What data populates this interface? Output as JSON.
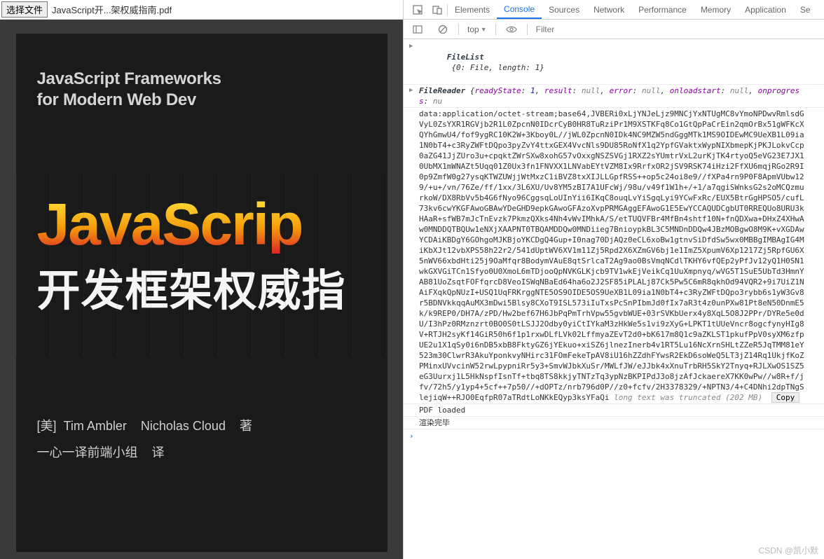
{
  "file_chooser": {
    "button_label": "选择文件",
    "file_name": "JavaScript开...架权威指南.pdf"
  },
  "book": {
    "subtitle_line1": "JavaScript Frameworks",
    "subtitle_line2": "for Modern Web Dev",
    "title_en": "JavaScrip",
    "title_cn": "开发框架权威指",
    "author_prefix": "[美]",
    "author1": "Tim Ambler",
    "author2": "Nicholas Cloud",
    "author_suffix": "著",
    "translator": "一心一译前端小组",
    "translator_suffix": "译"
  },
  "devtools": {
    "tabs": [
      "Elements",
      "Console",
      "Sources",
      "Network",
      "Performance",
      "Memory",
      "Application",
      "Se"
    ],
    "active_tab": "Console",
    "context_label": "top",
    "filter_placeholder": "Filter"
  },
  "console": {
    "filelist_label": "FileList",
    "filelist_body": "{0: File, length: 1}",
    "filereader_label": "FileReader",
    "filereader_props": [
      {
        "k": "readyState",
        "v": "1",
        "t": "num"
      },
      {
        "k": "result",
        "v": "null",
        "t": "nul"
      },
      {
        "k": "error",
        "v": "null",
        "t": "nul"
      },
      {
        "k": "onloadstart",
        "v": "null",
        "t": "nul"
      },
      {
        "k": "onprogress",
        "v": "nu",
        "t": "nul"
      }
    ],
    "data_url": "data:application/octet-stream;base64,JVBERi0xLjYNJeLjz9MNCjYxNTUgMC8vYmoNPDwvRmlsdGVyL0ZsYXR1RGVjb2R1L0ZpcnN0IDcrCyB0HR8TuRziPr1M9XSTKFq8Co1GtQpPaCrEin2qmOrBx51gWFKcXQYhGmwU4/fof9ygRC10K2W+3Kboy0L//jWL0ZpcnN0IDk4NC9MZW5ndGggMTk1MS9OIDEwMC9UeXB1L09ia1N0bT4+c3RyZWFtDQpo3pyZvY4ttxGEX4VvcNls9DU85RoNfX1q2YpfGVaktxWypNIXbmepKjPKJLokvCcp0aZG41JjZUro3u+cpqktZWrSXw8xohG57vOxxgNSZSVGj1RXZ2sYUmtrVxL2urKjTK4rtyoQ5eVG23E7JX10UbMX1mWNAZt5Uqq01Z0Ux3fn1FNVXX1LNVabEYtVZM8Ix9RrfxOR2jSV9RSK74iHzi2FfXU6mqjRGo2R9I0p9ZmfW0g27ysqKTWZUWjjWtMxzC1iBVZ8txXIJLLGpfRSS++op5c24oi8e9//fXPa4rn9P0F8ApmVUbw129/+u+/vn/76Ze/ff/1xx/3L6XU/Uv8YM5zBI7A1UFcWj/98u/v49f1W1h+/+1/a7qgiSWnksG2s2oMCQzmurkoW/DX8RbVv5b4G6fNyo96CggsqLoUInYii6IKqC8ouqLvYiSgqLyi9YCwFxRc/EUX5BtrGgHPSO5/cufL73kv6cwYKGFAwoGBAwYDeGHD9epkGAwoGFAzoXvpPRMGAggEFAwoG1E5EwYCCAQUDCgbUT0RREQUo8URU3kHAaR+sfWB7mJcTnEvzk7PkmzQXks4Nh4vWvIMhkA/S/etTUQVFBr4MfBn4shtf10N+fnQDXwa+DHxZ4XHwAw0MNDDQTBQUw1eNXjXAAPNT0TBQAMDDQw0MNDiieg7BnioypkBL3C5MNDnDDQw4JBzMOBgwO8M9K+vXGDAwYCDAiKBDgY6GOhgoMJKBjoYKCDgQ4Gup+I0nag70DjAQz0eCL6xoBw1gtnvSiDfdSw5wx0MBBgIMBAgIG4M\niKbXJt12vbXPS58h22r2/541dUptWV6XV1m11Zj5Rpd2X6XZmGV6bj1e1ImZ5XpumV6Xp1217Zj5RpfGU6X5nWV66xbdHti25j9OaMfqr8BodymVAuE8qtSrlcaT2Ag9ao0BsVmqNCdlTKHY6vfQEp2yPfJv12yQ1H0SN1wkGXVGiTCn1Sfyo0U0XmoL6mTDjooQpNVKGLKjcb9TV1wkEjVeikCq1UuXmpnyq/wVG5T1SuE5UbTd3HmnYAB81UoZsqtFOFfqrcD8VeoISWqNBaEd64ha6o2J2SF85iPLALj87Ck5Pw5C6mR8qkhOd94VQR2+9i7UiZ1NAiFXqkQpNUzI+USQ1UqFRKrggNTE5OS9OIDE5OS9UeXB1L09ia1N0bT4+c3RyZWFtDQpo3rybb6s1yW3Gv8r5BDNVkkqqAuMX3mDwi5Blsy8CXoT9ISL573iIuTxsPcSnPIbmJd0fIx7aR3t4z0unPXw81Pt8eN50DnmE5k/k9REP0/DH7A/zPD/Hw2bef67H6JbPqPmTrhVpw55gvbWUE+03rSVKbUerx4y8XqL5O8J2PPr/DYRe5e0dU/I3hPz0RMznzrt0BO0S0tLSJJ2Odby0yiCtIYkaM3zHkWe5s1vi9zXyG+LPKT1tUUeVncr8ogcfynyHIg8V+RTJH2syKf14GiR50h6f1p1rxwDLfLVk02LffmyaZEvT2d0+bK617m8Q1c9aZKLST1pkufPpV0syXM6zfpUE2u1X1qSy0i6nDB5xbB8FktyGZ6jYEkuo+xiSZ6jlnezInerb4v1RT5Lu16NcXrnSHLtZZeR5JqTMM81eY523m30ClwrR3AkuYponkvyNHirc31FOmFekeTpAV8iU16hZZdhFYwsR2EkD6soWeQ5LT3jZ14Rq1UkjfKoZPMinxUVvcinW52rwLpypniRr5y3+SmvWJbkXuSr/MWLfJW/eJJbk4xXnuTrbRH5SkY2Tnyq+RJLXwOS1SZ5eG3Uurxj1L5HkNspfIsnTf+tbq8TS8kkjyTNTzTq3ypNzBKPIPdJ3o8jzAfJckaereX7KK0wPw//w8R+f/jfv/72h5/y1yp4+5cf++7p50//+dOPTz/nrb796d0P//z0+fcfv/2H3378329/+NPTN3/4+C4DNhi2dpTNgSlejiqW++RJO0EqfpR07aTRdtLoNKkEQyp3ksYFaQi",
    "truncated_label": "long text was truncated (202 MB)",
    "copy_label": "Copy",
    "msg_pdf_loaded": "PDF loaded",
    "msg_render_done": "渲染完毕"
  },
  "watermark": "CSDN @凯小默"
}
